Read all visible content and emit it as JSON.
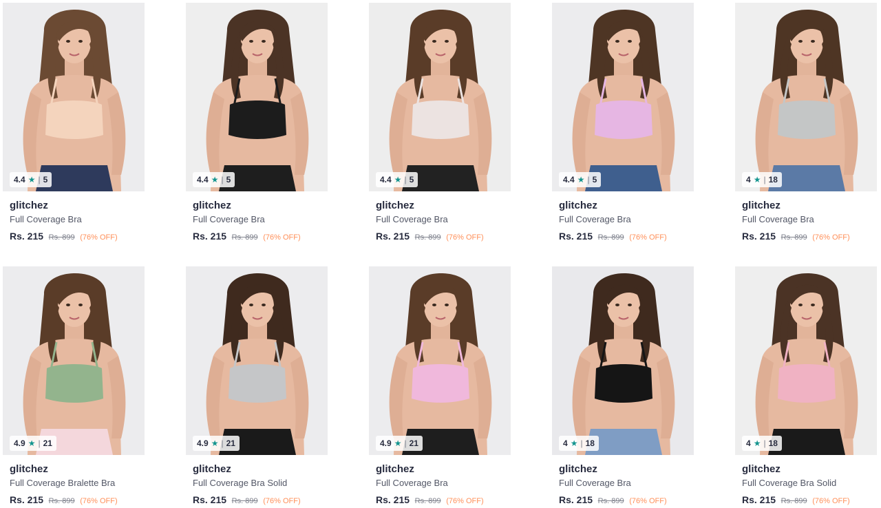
{
  "products": [
    {
      "rating": "4.4",
      "count": "5",
      "brand": "glitchez",
      "name": "Full Coverage Bra",
      "price": "Rs. 215",
      "mrp": "Rs. 899",
      "discount": "(76% OFF)",
      "bra_color": "#f4d4bd",
      "bg": "#ececee",
      "hair": "#6b4a33",
      "bottom": "#2e3a5c"
    },
    {
      "rating": "4.4",
      "count": "5",
      "brand": "glitchez",
      "name": "Full Coverage Bra",
      "price": "Rs. 215",
      "mrp": "Rs. 899",
      "discount": "(76% OFF)",
      "bra_color": "#1c1c1c",
      "bg": "#eeeeee",
      "hair": "#4b3325",
      "bottom": "#1e1e1e"
    },
    {
      "rating": "4.4",
      "count": "5",
      "brand": "glitchez",
      "name": "Full Coverage Bra",
      "price": "Rs. 215",
      "mrp": "Rs. 899",
      "discount": "(76% OFF)",
      "bra_color": "#ece3e1",
      "bg": "#ededed",
      "hair": "#5a3c28",
      "bottom": "#222222"
    },
    {
      "rating": "4.4",
      "count": "5",
      "brand": "glitchez",
      "name": "Full Coverage Bra",
      "price": "Rs. 215",
      "mrp": "Rs. 899",
      "discount": "(76% OFF)",
      "bra_color": "#e6b6e3",
      "bg": "#ececee",
      "hair": "#4e3524",
      "bottom": "#3f5f8e"
    },
    {
      "rating": "4",
      "count": "18",
      "brand": "glitchez",
      "name": "Full Coverage Bra",
      "price": "Rs. 215",
      "mrp": "Rs. 899",
      "discount": "(76% OFF)",
      "bra_color": "#c4c6c6",
      "bg": "#efefef",
      "hair": "#4e3524",
      "bottom": "#5b7aa6"
    },
    {
      "rating": "4.9",
      "count": "21",
      "brand": "glitchez",
      "name": "Full Coverage Bralette Bra",
      "price": "Rs. 215",
      "mrp": "Rs. 899",
      "discount": "(76% OFF)",
      "bra_color": "#93b48d",
      "bg": "#ececee",
      "hair": "#5a3c28",
      "bottom": "#f4d7dc"
    },
    {
      "rating": "4.9",
      "count": "21",
      "brand": "glitchez",
      "name": "Full Coverage Bra Solid",
      "price": "Rs. 215",
      "mrp": "Rs. 899",
      "discount": "(76% OFF)",
      "bra_color": "#c5c6c8",
      "bg": "#ececee",
      "hair": "#3f2a1e",
      "bottom": "#1a1a1a"
    },
    {
      "rating": "4.9",
      "count": "21",
      "brand": "glitchez",
      "name": "Full Coverage Bra",
      "price": "Rs. 215",
      "mrp": "Rs. 899",
      "discount": "(76% OFF)",
      "bra_color": "#f0b8dc",
      "bg": "#ececee",
      "hair": "#5a3c28",
      "bottom": "#1e1e1e"
    },
    {
      "rating": "4",
      "count": "18",
      "brand": "glitchez",
      "name": "Full Coverage Bra",
      "price": "Rs. 215",
      "mrp": "Rs. 899",
      "discount": "(76% OFF)",
      "bra_color": "#151515",
      "bg": "#e9e9ec",
      "hair": "#3f2a1e",
      "bottom": "#7f9dc4"
    },
    {
      "rating": "4",
      "count": "18",
      "brand": "glitchez",
      "name": "Full Coverage Bra Solid",
      "price": "Rs. 215",
      "mrp": "Rs. 899",
      "discount": "(76% OFF)",
      "bra_color": "#f0b2c3",
      "bg": "#eeeeee",
      "hair": "#4b3325",
      "bottom": "#1a1a1a"
    }
  ]
}
